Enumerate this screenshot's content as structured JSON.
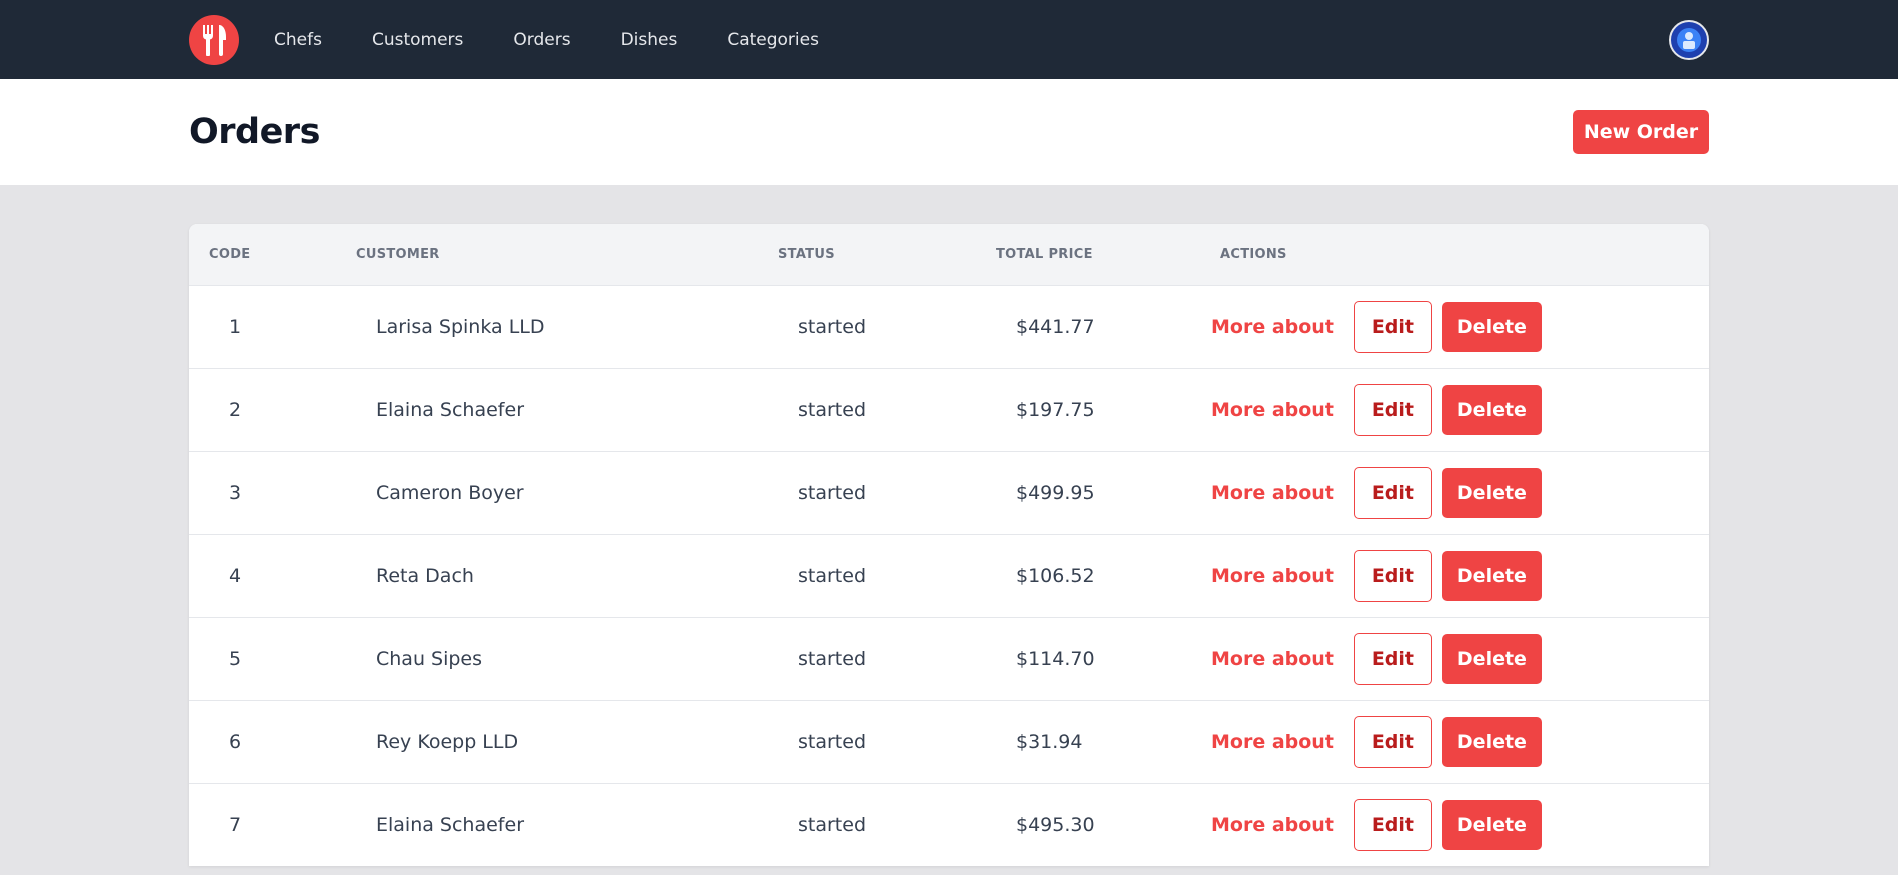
{
  "nav": {
    "logo_icon": "fork-knife-icon",
    "links": [
      "Chefs",
      "Customers",
      "Orders",
      "Dishes",
      "Categories"
    ],
    "avatar_icon": "avatar-icon"
  },
  "header": {
    "title": "Orders",
    "new_button": "New Order"
  },
  "table": {
    "columns": [
      "CODE",
      "CUSTOMER",
      "STATUS",
      "TOTAL PRICE",
      "ACTIONS"
    ],
    "rows": [
      {
        "code": "1",
        "customer": "Larisa Spinka LLD",
        "status": "started",
        "total": "$441.77"
      },
      {
        "code": "2",
        "customer": "Elaina Schaefer",
        "status": "started",
        "total": "$197.75"
      },
      {
        "code": "3",
        "customer": "Cameron Boyer",
        "status": "started",
        "total": "$499.95"
      },
      {
        "code": "4",
        "customer": "Reta Dach",
        "status": "started",
        "total": "$106.52"
      },
      {
        "code": "5",
        "customer": "Chau Sipes",
        "status": "started",
        "total": "$114.70"
      },
      {
        "code": "6",
        "customer": "Rey Koepp LLD",
        "status": "started",
        "total": "$31.94"
      },
      {
        "code": "7",
        "customer": "Elaina Schaefer",
        "status": "started",
        "total": "$495.30"
      }
    ],
    "actions": {
      "more": "More about",
      "edit": "Edit",
      "delete": "Delete"
    }
  },
  "colors": {
    "accent": "#ef4444",
    "nav_bg": "#1f2937",
    "page_bg": "#e4e4e7"
  }
}
